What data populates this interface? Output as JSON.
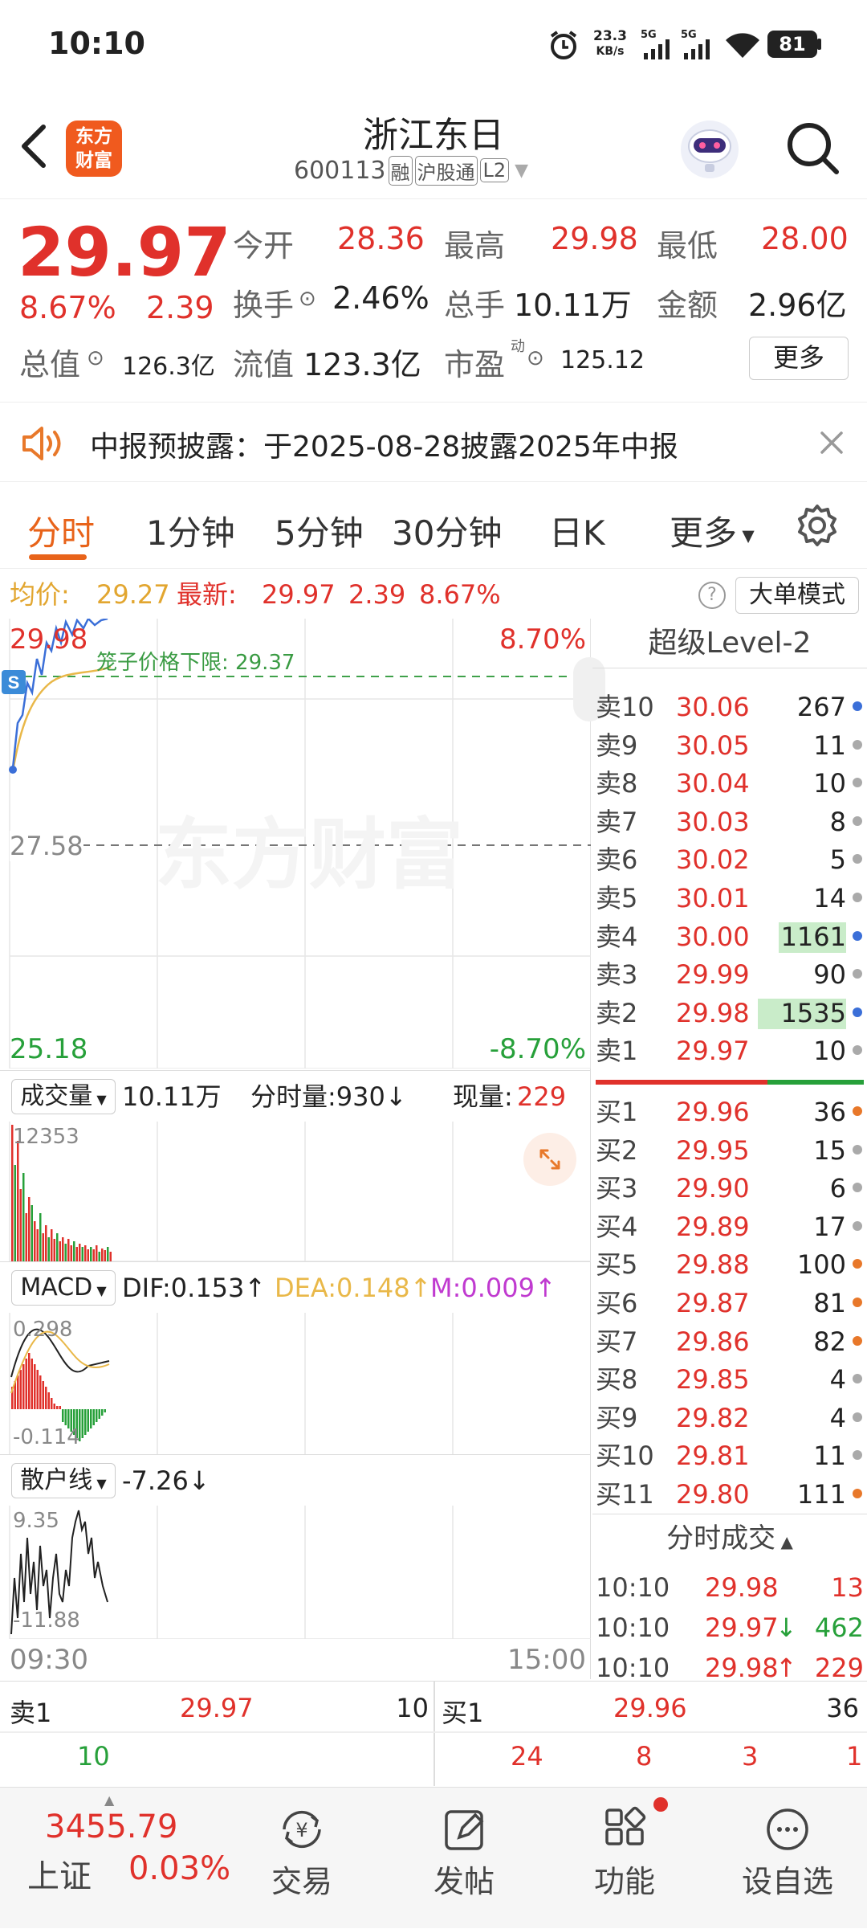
{
  "status": {
    "time": "10:10",
    "net_speed": "23.3",
    "net_unit": "KB/s",
    "sig1": "5G",
    "sig2": "5G",
    "battery": "81"
  },
  "header": {
    "logo_line1": "东方",
    "logo_line2": "财富",
    "name": "浙江东日",
    "code": "600113",
    "tag1": "融",
    "tag2": "沪股通",
    "tag3": "L2"
  },
  "quote": {
    "price": "29.97",
    "pct": "8.67%",
    "chg": "2.39",
    "open_label": "今开",
    "open": "28.36",
    "high_label": "最高",
    "high": "29.98",
    "low_label": "最低",
    "low": "28.00",
    "turnover_label": "换手",
    "turnover": "2.46%",
    "vol_label": "总手",
    "vol": "10.11万",
    "amount_label": "金额",
    "amount": "2.96亿",
    "mcap_label": "总值",
    "mcap": "126.3亿",
    "float_label": "流值",
    "float": "123.3亿",
    "pe_label": "市盈",
    "pe_sup": "动",
    "pe": "125.12",
    "more": "更多"
  },
  "notice": {
    "text": "中报预披露：于2025-08-28披露2025年中报"
  },
  "tabs": [
    "分时",
    "1分钟",
    "5分钟",
    "30分钟",
    "日K",
    "更多"
  ],
  "info_bar": {
    "avg_label": "均价:",
    "avg": "29.27",
    "latest_label": "最新:",
    "latest": "29.97",
    "chg": "2.39",
    "pct": "8.67%",
    "mode_btn": "大单模式"
  },
  "chart": {
    "top_price": "29.98",
    "top_pct": "8.70%",
    "cage_text": "笼子价格下限: 29.37",
    "mid_price": "27.58",
    "bottom_price": "25.18",
    "bottom_pct": "-8.70%",
    "watermark": "东方财富"
  },
  "volume": {
    "label": "成交量",
    "total": "10.11万",
    "tick_label": "分时量:930↓",
    "now_label": "现量:",
    "now": "229",
    "max": "12353"
  },
  "macd": {
    "label": "MACD",
    "dif": "DIF:0.153↑",
    "dea": "DEA:0.148↑",
    "m": "M:0.009↑",
    "top": "0.298",
    "bottom": "-0.114"
  },
  "retail": {
    "label": "散户线",
    "value": "-7.26↓",
    "top": "9.35",
    "bottom": "-11.88"
  },
  "time_axis": {
    "start": "09:30",
    "end": "15:00"
  },
  "level2": {
    "title": "超级Level-2",
    "sells": [
      {
        "label": "卖10",
        "price": "30.06",
        "vol": "267",
        "dot": "#3b6fd8"
      },
      {
        "label": "卖9",
        "price": "30.05",
        "vol": "11",
        "dot": "#aaaaaa"
      },
      {
        "label": "卖8",
        "price": "30.04",
        "vol": "10",
        "dot": "#aaaaaa"
      },
      {
        "label": "卖7",
        "price": "30.03",
        "vol": "8",
        "dot": "#aaaaaa"
      },
      {
        "label": "卖6",
        "price": "30.02",
        "vol": "5",
        "dot": "#aaaaaa"
      },
      {
        "label": "卖5",
        "price": "30.01",
        "vol": "14",
        "dot": "#aaaaaa"
      },
      {
        "label": "卖4",
        "price": "30.00",
        "vol": "1161",
        "dot": "#3b6fd8"
      },
      {
        "label": "卖3",
        "price": "29.99",
        "vol": "90",
        "dot": "#aaaaaa"
      },
      {
        "label": "卖2",
        "price": "29.98",
        "vol": "1535",
        "dot": "#3b6fd8"
      },
      {
        "label": "卖1",
        "price": "29.97",
        "vol": "10",
        "dot": "#aaaaaa"
      }
    ],
    "buys": [
      {
        "label": "买1",
        "price": "29.96",
        "vol": "36",
        "dot": "#e8782a"
      },
      {
        "label": "买2",
        "price": "29.95",
        "vol": "15",
        "dot": "#aaaaaa"
      },
      {
        "label": "买3",
        "price": "29.90",
        "vol": "6",
        "dot": "#aaaaaa"
      },
      {
        "label": "买4",
        "price": "29.89",
        "vol": "17",
        "dot": "#aaaaaa"
      },
      {
        "label": "买5",
        "price": "29.88",
        "vol": "100",
        "dot": "#e8782a"
      },
      {
        "label": "买6",
        "price": "29.87",
        "vol": "81",
        "dot": "#e8782a"
      },
      {
        "label": "买7",
        "price": "29.86",
        "vol": "82",
        "dot": "#e8782a"
      },
      {
        "label": "买8",
        "price": "29.85",
        "vol": "4",
        "dot": "#aaaaaa"
      },
      {
        "label": "买9",
        "price": "29.82",
        "vol": "4",
        "dot": "#aaaaaa"
      },
      {
        "label": "买10",
        "price": "29.81",
        "vol": "11",
        "dot": "#aaaaaa"
      },
      {
        "label": "买11",
        "price": "29.80",
        "vol": "111",
        "dot": "#e8782a"
      }
    ],
    "ticks_title": "分时成交",
    "ticks": [
      {
        "time": "10:10",
        "price": "29.98",
        "arrow": "",
        "vol": "13",
        "vcolor": "#e0312b"
      },
      {
        "time": "10:10",
        "price": "29.97",
        "arrow": "↓",
        "vol": "462",
        "vcolor": "#27a03a"
      },
      {
        "time": "10:10",
        "price": "29.98",
        "arrow": "↑",
        "vol": "229",
        "vcolor": "#e0312b"
      }
    ]
  },
  "bottom_book": {
    "sell_label": "卖1",
    "sell_price": "29.97",
    "sell_vol": "10",
    "sell_sub": "10",
    "buy_label": "买1",
    "buy_price": "29.96",
    "buy_vol": "36",
    "buy_subs": [
      "24",
      "8",
      "3",
      "1"
    ]
  },
  "index": {
    "value": "3455.79",
    "name": "上证",
    "pct": "0.03%"
  },
  "nav": [
    "交易",
    "发帖",
    "功能",
    "设自选"
  ]
}
